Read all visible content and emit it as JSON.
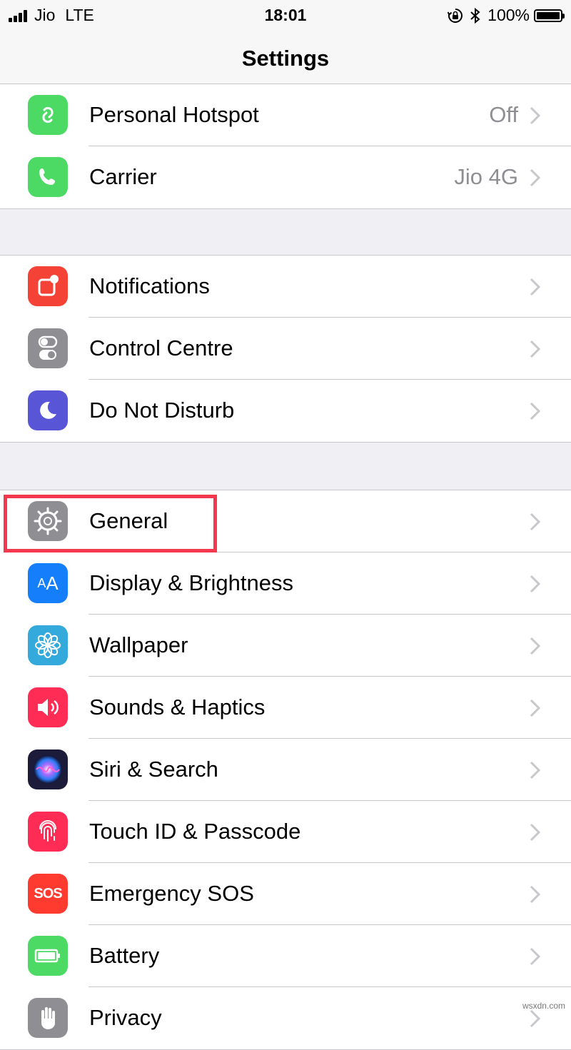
{
  "status_bar": {
    "carrier": "Jio",
    "network": "LTE",
    "time": "18:01",
    "battery": "100%"
  },
  "nav": {
    "title": "Settings"
  },
  "groups": [
    {
      "items": [
        {
          "label": "Personal Hotspot",
          "value": "Off",
          "icon": "hotspot-icon",
          "color": "#4cd964"
        },
        {
          "label": "Carrier",
          "value": "Jio 4G",
          "icon": "phone-icon",
          "color": "#4cd964"
        }
      ]
    },
    {
      "items": [
        {
          "label": "Notifications",
          "icon": "notifications-icon",
          "color": "#f44336"
        },
        {
          "label": "Control Centre",
          "icon": "toggles-icon",
          "color": "#8e8e93"
        },
        {
          "label": "Do Not Disturb",
          "icon": "moon-icon",
          "color": "#5856d6"
        }
      ]
    },
    {
      "items": [
        {
          "label": "General",
          "icon": "gear-icon",
          "color": "#8e8e93"
        },
        {
          "label": "Display & Brightness",
          "icon": "text-size-icon",
          "color": "#147efb"
        },
        {
          "label": "Wallpaper",
          "icon": "flower-icon",
          "color": "#34aadc"
        },
        {
          "label": "Sounds & Haptics",
          "icon": "speaker-icon",
          "color": "#ff2d55"
        },
        {
          "label": "Siri & Search",
          "icon": "siri-icon",
          "color": "#1c1c3a"
        },
        {
          "label": "Touch ID & Passcode",
          "icon": "fingerprint-icon",
          "color": "#ff2d55"
        },
        {
          "label": "Emergency SOS",
          "icon": "sos-icon",
          "icon_text": "SOS",
          "color": "#ff3b30"
        },
        {
          "label": "Battery",
          "icon": "battery-icon",
          "color": "#4cd964"
        },
        {
          "label": "Privacy",
          "icon": "hand-icon",
          "color": "#8e8e93"
        }
      ]
    }
  ],
  "watermark": "wsxdn.com"
}
